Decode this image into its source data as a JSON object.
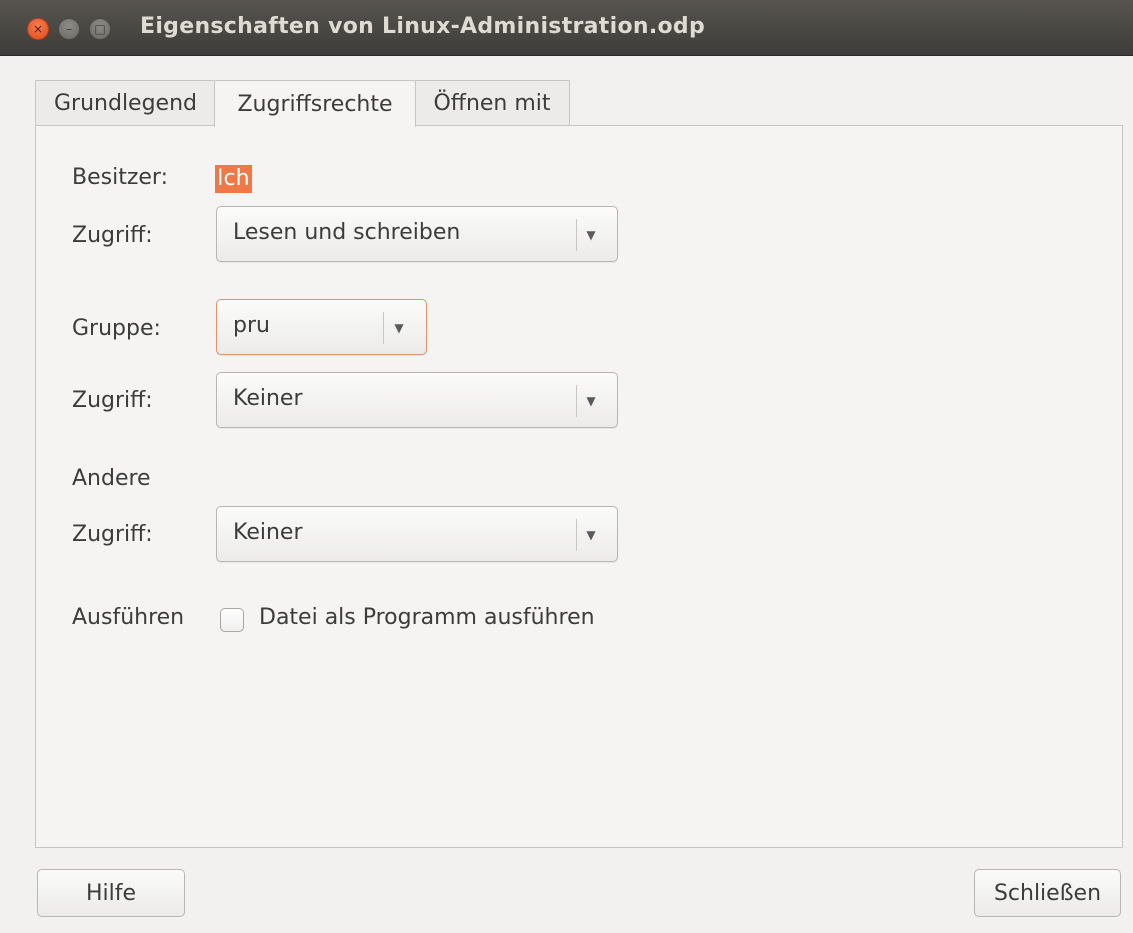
{
  "window": {
    "title": "Eigenschaften von Linux-Administration.odp",
    "controls": {
      "close_glyph": "×",
      "minimize_glyph": "–",
      "maximize_glyph": "□"
    }
  },
  "tabs": [
    {
      "label": "Grundlegend",
      "active": false
    },
    {
      "label": "Zugriffsrechte",
      "active": true
    },
    {
      "label": "Öffnen mit",
      "active": false
    }
  ],
  "permissions": {
    "owner": {
      "label": "Besitzer:",
      "value": "Ich"
    },
    "owner_access": {
      "label": "Zugriff:",
      "value": "Lesen und schreiben"
    },
    "group": {
      "label": "Gruppe:",
      "value": "pru"
    },
    "group_access": {
      "label": "Zugriff:",
      "value": "Keiner"
    },
    "others": {
      "label": "Andere"
    },
    "others_access": {
      "label": "Zugriff:",
      "value": "Keiner"
    },
    "execute": {
      "label": "Ausführen",
      "checkbox_label": "Datei als Programm ausführen",
      "checked": false
    }
  },
  "buttons": {
    "help": "Hilfe",
    "close": "Schließen"
  },
  "icons": {
    "dropdown": "▼"
  },
  "colors": {
    "accent": "#f07746",
    "focus_border": "#e0926e",
    "titlebar": "#3e3d39"
  }
}
